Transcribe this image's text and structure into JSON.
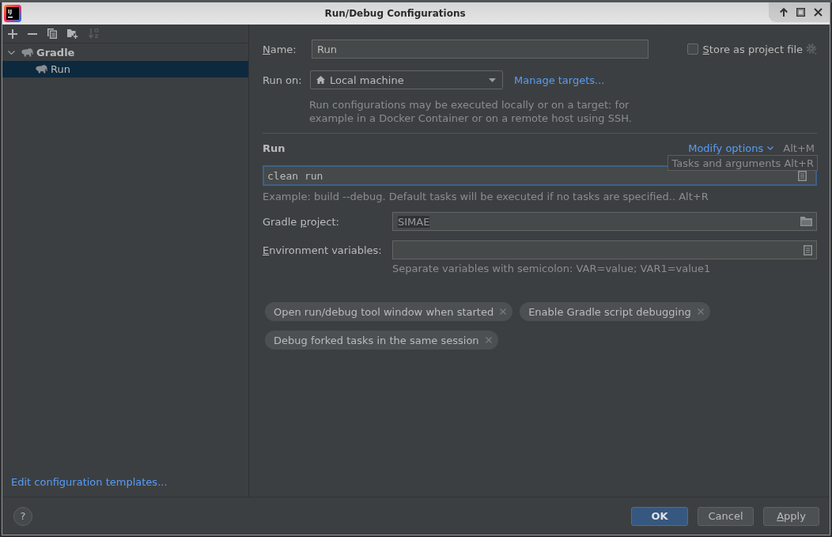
{
  "window": {
    "logo_text": "IJ",
    "title": "Run/Debug Configurations"
  },
  "toolbar": [
    {
      "kind": "add",
      "disabled": false
    },
    {
      "kind": "remove",
      "disabled": false
    },
    {
      "kind": "copy",
      "disabled": false
    },
    {
      "kind": "new-folder",
      "disabled": false
    },
    {
      "kind": "sort",
      "disabled": true
    }
  ],
  "tree": [
    {
      "label": "Gradle",
      "expanded": true,
      "selected": false,
      "children": [
        {
          "label": "Run",
          "selected": true
        }
      ]
    }
  ],
  "templates_link": "Edit configuration templates...",
  "name": {
    "label": {
      "key": "N",
      "post": "ame:"
    },
    "value": "Run"
  },
  "store_as_project_file": {
    "label": {
      "key": "S",
      "post": "tore as project file"
    },
    "checked": false
  },
  "run_on": {
    "label": "Run on:",
    "value": "Local machine",
    "link": "Manage targets...",
    "description": "Run configurations may be executed locally or on a target: for example in a Docker Container or on a remote host using SSH."
  },
  "run_section": {
    "title": "Run",
    "modify_options": "Modify options",
    "modify_shortcut": "Alt+M",
    "tasks": {
      "value": "clean run",
      "focused": true,
      "tooltip": "Tasks and arguments Alt+R",
      "hint": "Example: build --debug. Default tasks will be executed if no tasks are specified.. Alt+R"
    },
    "gradle_project": {
      "label": {
        "pre": "Gradle ",
        "key": "p",
        "post": "roject:"
      },
      "value": "SIMAE",
      "value_selected": true
    },
    "environment_variables": {
      "label": {
        "key": "E",
        "post": "nvironment variables:"
      },
      "hint": "Separate variables with semicolon: VAR=value; VAR1=value1"
    },
    "options": [
      "Open run/debug tool window when started",
      "Enable Gradle script debugging",
      "Debug forked tasks in the same session"
    ]
  },
  "footer": {
    "help": "?",
    "buttons": [
      {
        "label": "OK",
        "default": true
      },
      {
        "label": "Cancel",
        "default": false
      },
      {
        "label": {
          "key": "A",
          "post": "pply"
        },
        "default": false
      }
    ]
  }
}
